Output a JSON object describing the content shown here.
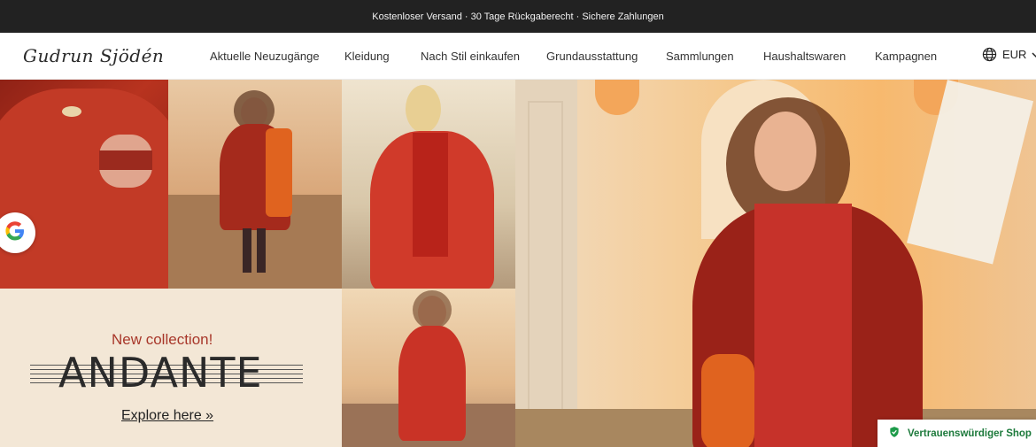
{
  "topbar": {
    "text": "Kostenloser Versand · 30 Tage Rückgaberecht · Sichere Zahlungen"
  },
  "header": {
    "logo": "Gudrun Sjödén",
    "nav": [
      "Aktuelle Neuzugänge",
      "Kleidung",
      "Nach Stil einkaufen",
      "Grundausstattung",
      "Sammlungen",
      "Haushaltswaren",
      "Kampagnen"
    ],
    "currency": "EUR"
  },
  "hero": {
    "new_collection": "New collection!",
    "title": "ANDANTE",
    "cta": "Explore here »"
  },
  "trust_badge": "Vertrauenswürdiger Shop",
  "icons": [
    "globe-icon",
    "chevron-down-icon",
    "google-icon",
    "shield-check-icon"
  ],
  "colors": {
    "topbar_bg": "#222222",
    "accent_red": "#a8372a",
    "trust_green": "#1d7a3c"
  }
}
